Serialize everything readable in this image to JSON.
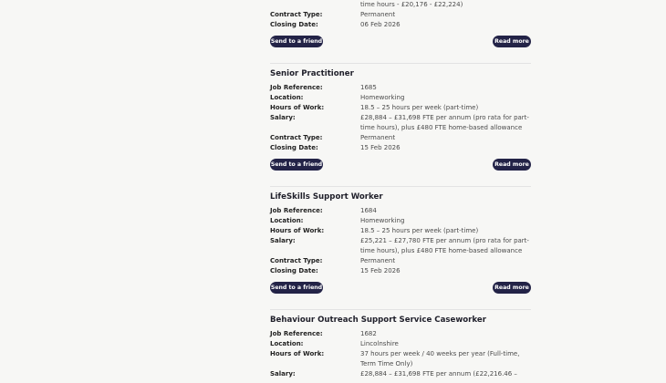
{
  "labels": {
    "job_reference": "Job Reference:",
    "location": "Location:",
    "hours": "Hours of Work:",
    "salary": "Salary:",
    "contract": "Contract Type:",
    "closing": "Closing Date:"
  },
  "buttons": {
    "send": "Send to a friend",
    "read": "Read more"
  },
  "jobs": [
    {
      "salary_tail": "time hours - £20,176 - £22,224)",
      "contract": "Permanent",
      "closing": "06 Feb 2026"
    },
    {
      "title": "Senior Practitioner",
      "reference": "1685",
      "location": "Homeworking",
      "hours": "18.5 – 25 hours per week (part-time)",
      "salary": "£28,884 – £31,698 FTE per annum (pro rata for part-time hours), plus £480 FTE home-based allowance",
      "contract": "Permanent",
      "closing": "15 Feb 2026"
    },
    {
      "title": "LifeSkills Support Worker",
      "reference": "1684",
      "location": "Homeworking",
      "hours": "18.5 – 25 hours per week (part-time)",
      "salary": "£25,221 – £27,780 FTE per annum (pro rata for part-time hours), plus £480 FTE home-based allowance",
      "contract": "Permanent",
      "closing": "15 Feb 2026"
    },
    {
      "title": "Behaviour Outreach Support Service Caseworker",
      "reference": "1682",
      "location": "Lincolnshire",
      "hours": "37 hours per week / 40 weeks per year (Full-time, Term Time Only)",
      "salary": "£28,884 – £31,698 FTE per annum (£22,216.46 –"
    }
  ]
}
